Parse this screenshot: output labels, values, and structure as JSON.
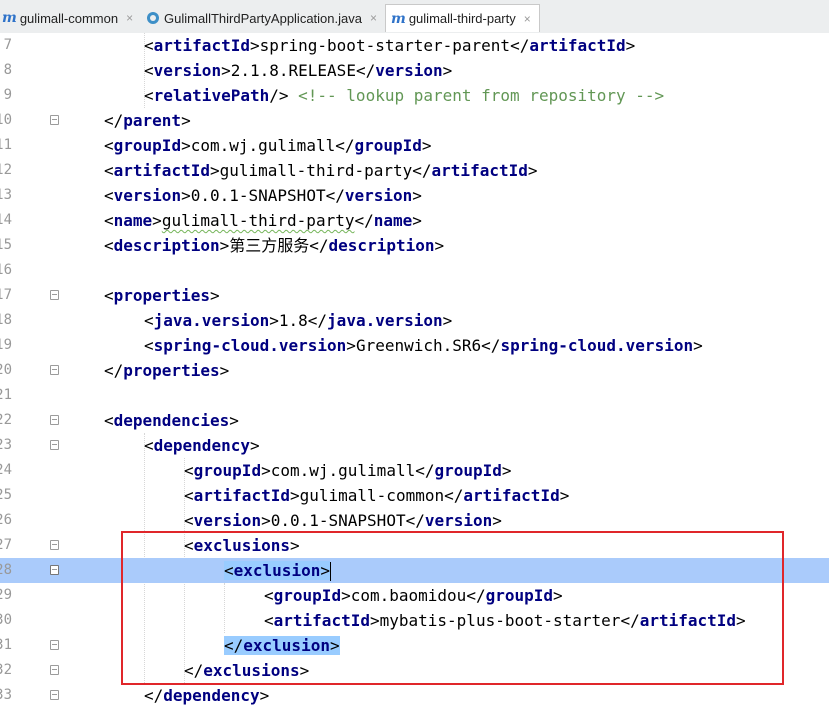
{
  "tabs": [
    {
      "label": "gulimall-common",
      "icon": "maven-m-icon",
      "active": false
    },
    {
      "label": "GulimallThirdPartyApplication.java",
      "icon": "java-class-icon",
      "active": false
    },
    {
      "label": "gulimall-third-party",
      "icon": "maven-m-icon",
      "active": true
    }
  ],
  "tab_close_glyph": "×",
  "lines": [
    {
      "num": "7",
      "fold": "",
      "indent": 2,
      "parts": [
        [
          "t",
          "<"
        ],
        [
          "n",
          "artifactId"
        ],
        [
          "t",
          ">"
        ],
        [
          "x",
          "spring-boot-starter-parent"
        ],
        [
          "t",
          "</"
        ],
        [
          "n",
          "artifactId"
        ],
        [
          "t",
          ">"
        ]
      ]
    },
    {
      "num": "8",
      "fold": "",
      "indent": 2,
      "parts": [
        [
          "t",
          "<"
        ],
        [
          "n",
          "version"
        ],
        [
          "t",
          ">"
        ],
        [
          "x",
          "2.1.8.RELEASE"
        ],
        [
          "t",
          "</"
        ],
        [
          "n",
          "version"
        ],
        [
          "t",
          ">"
        ]
      ]
    },
    {
      "num": "9",
      "fold": "",
      "indent": 2,
      "parts": [
        [
          "t",
          "<"
        ],
        [
          "n",
          "relativePath"
        ],
        [
          "t",
          "/>"
        ],
        [
          "c",
          " <!-- lookup parent from repository -->"
        ]
      ]
    },
    {
      "num": "10",
      "fold": "end",
      "indent": 1,
      "parts": [
        [
          "t",
          "</"
        ],
        [
          "n",
          "parent"
        ],
        [
          "t",
          ">"
        ]
      ]
    },
    {
      "num": "11",
      "fold": "",
      "indent": 1,
      "parts": [
        [
          "t",
          "<"
        ],
        [
          "n",
          "groupId"
        ],
        [
          "t",
          ">"
        ],
        [
          "x",
          "com.wj.gulimall"
        ],
        [
          "t",
          "</"
        ],
        [
          "n",
          "groupId"
        ],
        [
          "t",
          ">"
        ]
      ]
    },
    {
      "num": "12",
      "fold": "",
      "indent": 1,
      "parts": [
        [
          "t",
          "<"
        ],
        [
          "n",
          "artifactId"
        ],
        [
          "t",
          ">"
        ],
        [
          "x",
          "gulimall-third-party"
        ],
        [
          "t",
          "</"
        ],
        [
          "n",
          "artifactId"
        ],
        [
          "t",
          ">"
        ]
      ]
    },
    {
      "num": "13",
      "fold": "",
      "indent": 1,
      "parts": [
        [
          "t",
          "<"
        ],
        [
          "n",
          "version"
        ],
        [
          "t",
          ">"
        ],
        [
          "x",
          "0.0.1-SNAPSHOT"
        ],
        [
          "t",
          "</"
        ],
        [
          "n",
          "version"
        ],
        [
          "t",
          ">"
        ]
      ]
    },
    {
      "num": "14",
      "fold": "",
      "indent": 1,
      "parts": [
        [
          "t",
          "<"
        ],
        [
          "n",
          "name"
        ],
        [
          "t",
          ">"
        ],
        [
          "x",
          "gulimall-third-party"
        ],
        [
          "t",
          "</"
        ],
        [
          "n",
          "name"
        ],
        [
          "t",
          ">"
        ]
      ]
    },
    {
      "num": "15",
      "fold": "",
      "indent": 1,
      "parts": [
        [
          "t",
          "<"
        ],
        [
          "n",
          "description"
        ],
        [
          "t",
          ">"
        ],
        [
          "x",
          "第三方服务"
        ],
        [
          "t",
          "</"
        ],
        [
          "n",
          "description"
        ],
        [
          "t",
          ">"
        ]
      ]
    },
    {
      "num": "16",
      "fold": "",
      "indent": 1,
      "parts": []
    },
    {
      "num": "17",
      "fold": "start",
      "indent": 1,
      "parts": [
        [
          "t",
          "<"
        ],
        [
          "n",
          "properties"
        ],
        [
          "t",
          ">"
        ]
      ]
    },
    {
      "num": "18",
      "fold": "",
      "indent": 2,
      "parts": [
        [
          "t",
          "<"
        ],
        [
          "n",
          "java.version"
        ],
        [
          "t",
          ">"
        ],
        [
          "x",
          "1.8"
        ],
        [
          "t",
          "</"
        ],
        [
          "n",
          "java.version"
        ],
        [
          "t",
          ">"
        ]
      ]
    },
    {
      "num": "19",
      "fold": "",
      "indent": 2,
      "parts": [
        [
          "t",
          "<"
        ],
        [
          "n",
          "spring-cloud.version"
        ],
        [
          "t",
          ">"
        ],
        [
          "x",
          "Greenwich.SR6"
        ],
        [
          "t",
          "</"
        ],
        [
          "n",
          "spring-cloud.version"
        ],
        [
          "t",
          ">"
        ]
      ]
    },
    {
      "num": "20",
      "fold": "end",
      "indent": 1,
      "parts": [
        [
          "t",
          "</"
        ],
        [
          "n",
          "properties"
        ],
        [
          "t",
          ">"
        ]
      ]
    },
    {
      "num": "21",
      "fold": "",
      "indent": 1,
      "parts": []
    },
    {
      "num": "22",
      "fold": "start",
      "indent": 1,
      "parts": [
        [
          "t",
          "<"
        ],
        [
          "n",
          "dependencies"
        ],
        [
          "t",
          ">"
        ]
      ]
    },
    {
      "num": "23",
      "fold": "start",
      "indent": 2,
      "parts": [
        [
          "t",
          "<"
        ],
        [
          "n",
          "dependency"
        ],
        [
          "t",
          ">"
        ]
      ]
    },
    {
      "num": "24",
      "fold": "",
      "indent": 3,
      "parts": [
        [
          "t",
          "<"
        ],
        [
          "n",
          "groupId"
        ],
        [
          "t",
          ">"
        ],
        [
          "x",
          "com.wj.gulimall"
        ],
        [
          "t",
          "</"
        ],
        [
          "n",
          "groupId"
        ],
        [
          "t",
          ">"
        ]
      ]
    },
    {
      "num": "25",
      "fold": "",
      "indent": 3,
      "parts": [
        [
          "t",
          "<"
        ],
        [
          "n",
          "artifactId"
        ],
        [
          "t",
          ">"
        ],
        [
          "x",
          "gulimall-common"
        ],
        [
          "t",
          "</"
        ],
        [
          "n",
          "artifactId"
        ],
        [
          "t",
          ">"
        ]
      ]
    },
    {
      "num": "26",
      "fold": "",
      "indent": 3,
      "parts": [
        [
          "t",
          "<"
        ],
        [
          "n",
          "version"
        ],
        [
          "t",
          ">"
        ],
        [
          "x",
          "0.0.1-SNAPSHOT"
        ],
        [
          "t",
          "</"
        ],
        [
          "n",
          "version"
        ],
        [
          "t",
          ">"
        ]
      ]
    },
    {
      "num": "27",
      "fold": "start",
      "indent": 3,
      "parts": [
        [
          "t",
          "<"
        ],
        [
          "n",
          "exclusions"
        ],
        [
          "t",
          ">"
        ]
      ]
    },
    {
      "num": "28",
      "fold": "caret",
      "indent": 4,
      "caret": true,
      "parts": [
        [
          "th",
          "<"
        ],
        [
          "nh",
          "exclusion"
        ],
        [
          "th",
          ">"
        ],
        [
          "caret",
          ""
        ]
      ]
    },
    {
      "num": "29",
      "fold": "",
      "indent": 5,
      "parts": [
        [
          "t",
          "<"
        ],
        [
          "n",
          "groupId"
        ],
        [
          "t",
          ">"
        ],
        [
          "x",
          "com.baomidou"
        ],
        [
          "t",
          "</"
        ],
        [
          "n",
          "groupId"
        ],
        [
          "t",
          ">"
        ]
      ]
    },
    {
      "num": "30",
      "fold": "",
      "indent": 5,
      "parts": [
        [
          "t",
          "<"
        ],
        [
          "n",
          "artifactId"
        ],
        [
          "t",
          ">"
        ],
        [
          "x",
          "mybatis-plus-boot-starter"
        ],
        [
          "t",
          "</"
        ],
        [
          "n",
          "artifactId"
        ],
        [
          "t",
          ">"
        ]
      ]
    },
    {
      "num": "31",
      "fold": "end",
      "indent": 4,
      "parts": [
        [
          "th",
          "</"
        ],
        [
          "nh",
          "exclusion"
        ],
        [
          "th",
          ">"
        ]
      ]
    },
    {
      "num": "32",
      "fold": "end",
      "indent": 3,
      "parts": [
        [
          "t",
          "</"
        ],
        [
          "n",
          "exclusions"
        ],
        [
          "t",
          ">"
        ]
      ]
    },
    {
      "num": "33",
      "fold": "end",
      "indent": 2,
      "parts": [
        [
          "t",
          "</"
        ],
        [
          "n",
          "dependency"
        ],
        [
          "t",
          ">"
        ]
      ]
    }
  ],
  "colors": {
    "tag_name": "#000080",
    "comment": "#629755",
    "caret_line": "#aacbfb",
    "brace_match": "#99ccff",
    "annotation_box": "#e0262a",
    "active_tab_icon": "#2f73c9"
  }
}
